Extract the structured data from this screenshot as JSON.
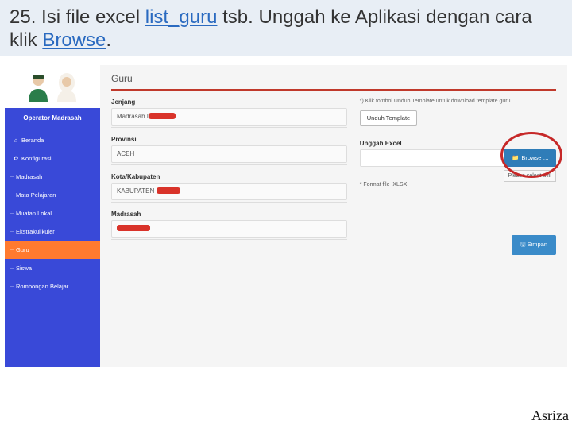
{
  "slide": {
    "prefix": "25. Isi file excel ",
    "link1": "list_guru",
    "mid": " tsb. Unggah ke Aplikasi dengan cara klik ",
    "link2": "Browse",
    "suffix": "."
  },
  "sidebar": {
    "title": "Operator Madrasah",
    "items": [
      {
        "label": "Beranda",
        "icon": "⌂"
      },
      {
        "label": "Konfigurasi",
        "icon": "✿"
      },
      {
        "label": "Madrasah"
      },
      {
        "label": "Mata Pelajaran"
      },
      {
        "label": "Muatan Lokal"
      },
      {
        "label": "Ekstrakulikuler"
      },
      {
        "label": "Guru"
      },
      {
        "label": "Siswa"
      },
      {
        "label": "Rombongan Belajar"
      }
    ]
  },
  "page": {
    "title": "Guru",
    "jenjang_label": "Jenjang",
    "jenjang_value": "Madrasah I",
    "provinsi_label": "Provinsi",
    "provinsi_value": "ACEH",
    "kab_label": "Kota/Kabupaten",
    "kab_value": "KABUPATEN ",
    "madrasah_label": "Madrasah",
    "template_note": "*) Klik tombol Unduh Template untuk download template guru.",
    "unduh_btn": "Unduh Template",
    "unggah_label": "Unggah Excel",
    "browse_label": "Browse …",
    "select_hint": "Please select a fil",
    "format_note": "* Format file .XLSX",
    "save_label": "Simpan",
    "save_icon": "🖫"
  },
  "footer": "Asriza"
}
